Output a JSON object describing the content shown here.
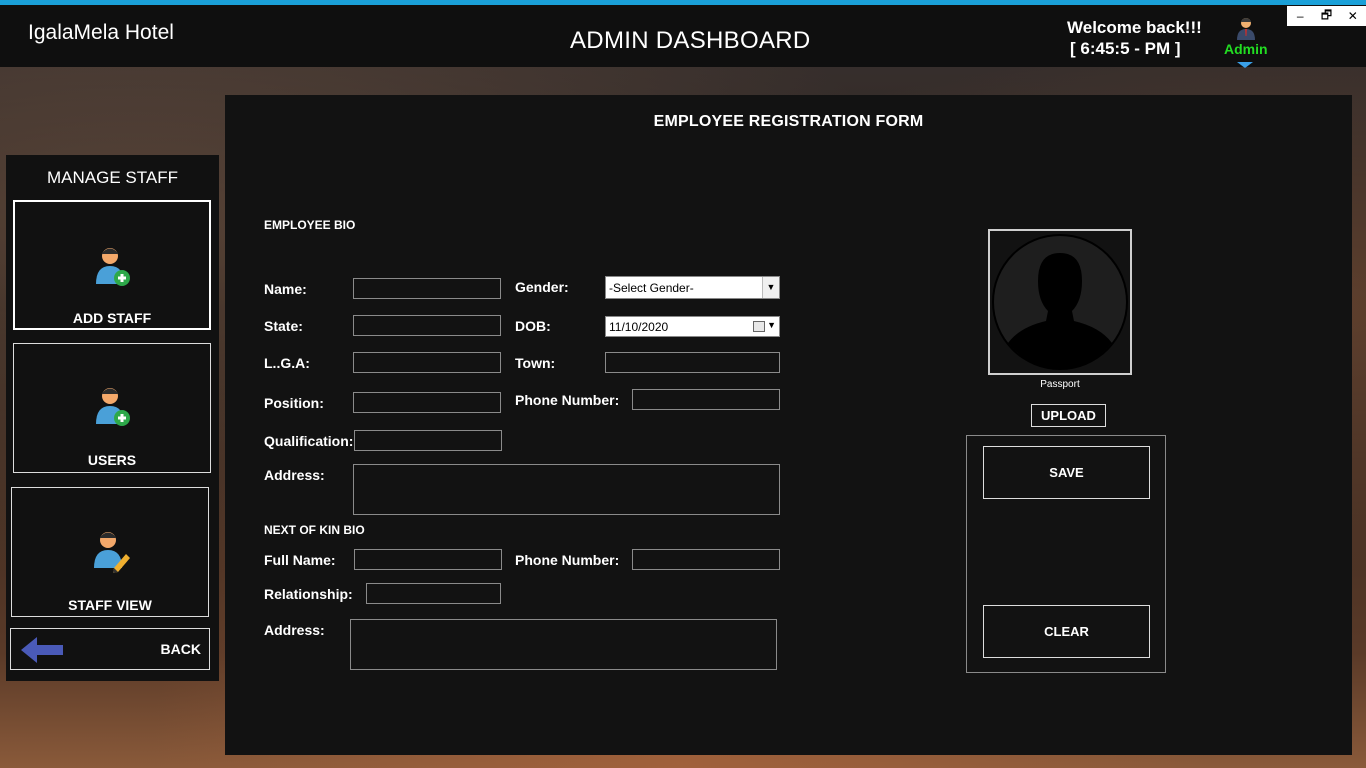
{
  "header": {
    "brand": "IgalaMela Hotel",
    "title": "ADMIN DASHBOARD",
    "welcome": "Welcome back!!!",
    "clock": "[ 6:45:5 - PM ]",
    "user_label": "Admin",
    "accent_color": "#1aa0d8",
    "user_color": "#22dd22"
  },
  "window_controls": {
    "minimize": "‒",
    "restore": "🗗",
    "close": "✕"
  },
  "sidebar": {
    "title": "MANAGE STAFF",
    "items": [
      {
        "label": "ADD STAFF",
        "icon": "add-user-icon"
      },
      {
        "label": "USERS",
        "icon": "add-user-icon"
      },
      {
        "label": "STAFF VIEW",
        "icon": "edit-user-icon"
      }
    ],
    "back_label": "BACK",
    "back_icon": "arrow-left-icon"
  },
  "form": {
    "title": "EMPLOYEE REGISTRATION FORM",
    "bio_section": "EMPLOYEE BIO",
    "labels": {
      "name": "Name:",
      "gender": "Gender:",
      "state": "State:",
      "dob": "DOB:",
      "lga": "L..G.A:",
      "town": "Town:",
      "position": "Position:",
      "phone": "Phone Number:",
      "qualification": "Qualification:",
      "address": "Address:"
    },
    "gender_selected": "-Select Gender-",
    "dob_value": "11/10/2020",
    "kin_section": "NEXT OF KIN BIO",
    "kin_labels": {
      "full_name": "Full Name:",
      "phone": "Phone Number:",
      "relationship": "Relationship:",
      "address": "Address:"
    },
    "passport_label": "Passport",
    "upload_label": "UPLOAD",
    "save_label": "SAVE",
    "clear_label": "CLEAR"
  }
}
